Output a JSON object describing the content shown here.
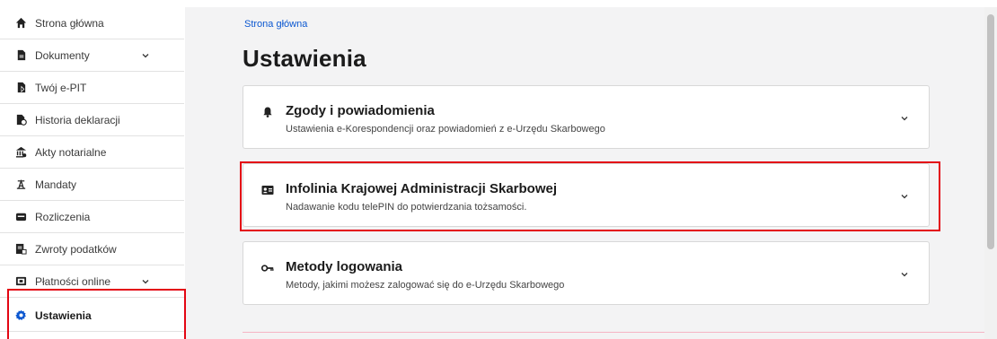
{
  "sidebar": {
    "items": [
      {
        "label": "Strona główna",
        "icon": "home-icon"
      },
      {
        "label": "Dokumenty",
        "icon": "document-icon",
        "expandable": true
      },
      {
        "label": "Twój e-PIT",
        "icon": "epit-icon"
      },
      {
        "label": "Historia deklaracji",
        "icon": "history-icon"
      },
      {
        "label": "Akty notarialne",
        "icon": "notary-icon"
      },
      {
        "label": "Mandaty",
        "icon": "ticket-icon"
      },
      {
        "label": "Rozliczenia",
        "icon": "wallet-icon"
      },
      {
        "label": "Zwroty podatków",
        "icon": "refund-icon"
      },
      {
        "label": "Płatności online",
        "icon": "payment-icon",
        "expandable": true
      },
      {
        "label": "Ustawienia",
        "icon": "gear-icon",
        "active": true
      }
    ]
  },
  "main": {
    "breadcrumb": "Strona główna",
    "title": "Ustawienia",
    "cards": [
      {
        "title": "Zgody i powiadomienia",
        "description": "Ustawienia e-Korespondencji oraz powiadomień z e-Urzędu Skarbowego",
        "icon": "bell-icon"
      },
      {
        "title": "Infolinia Krajowej Administracji Skarbowej",
        "description": "Nadawanie kodu telePIN do potwierdzania tożsamości.",
        "icon": "id-card-icon"
      },
      {
        "title": "Metody logowania",
        "description": "Metody, jakimi możesz zalogować się do e-Urzędu Skarbowego",
        "icon": "key-icon"
      }
    ]
  },
  "colors": {
    "accent": "#0b57d0",
    "highlight": "#e30613",
    "active_icon": "#0b57d0"
  }
}
